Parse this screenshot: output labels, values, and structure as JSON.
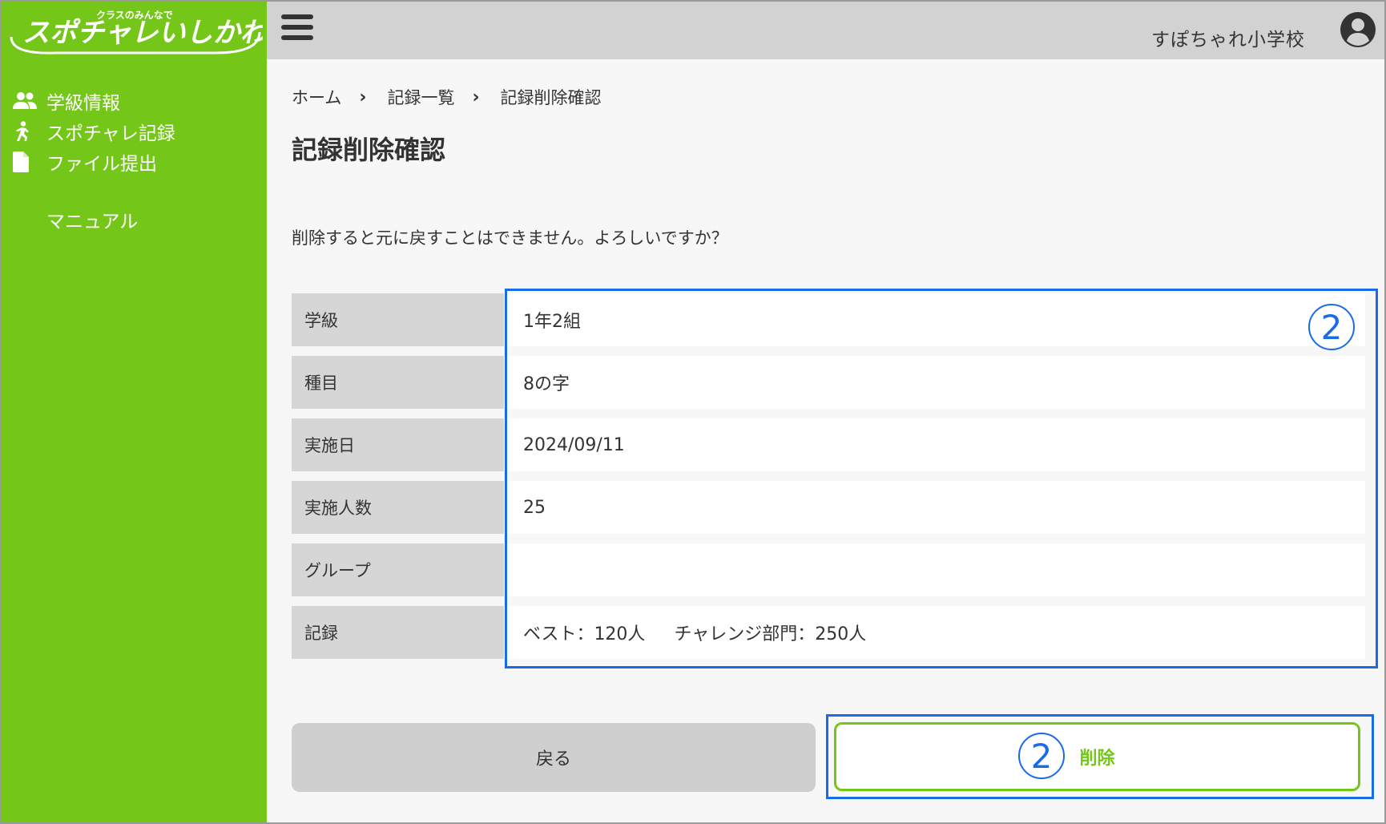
{
  "sidebar": {
    "logo_main": "スポチャレいしかわ",
    "logo_sub": "クラスのみんなで",
    "items": [
      {
        "icon": "users-icon",
        "label": "学級情報"
      },
      {
        "icon": "runner-icon",
        "label": "スポチャレ記録"
      },
      {
        "icon": "file-icon",
        "label": "ファイル提出"
      }
    ],
    "manual_label": "マニュアル"
  },
  "header": {
    "school_name": "すぽちゃれ小学校"
  },
  "breadcrumb": {
    "home": "ホーム",
    "list": "記録一覧",
    "current": "記録削除確認"
  },
  "page": {
    "title": "記録削除確認",
    "message": "削除すると元に戻すことはできません。よろしいですか？"
  },
  "table": {
    "rows": [
      {
        "label": "学級",
        "value": "1年2組"
      },
      {
        "label": "種目",
        "value": "8の字"
      },
      {
        "label": "実施日",
        "value": "2024/09/11"
      },
      {
        "label": "実施人数",
        "value": "25"
      },
      {
        "label": "グループ",
        "value": ""
      },
      {
        "label": "記録",
        "value_best": "ベスト：120人",
        "value_challenge": "チャレンジ部門：250人"
      }
    ]
  },
  "annotations": {
    "marker_table": "2",
    "marker_button": "2",
    "highlight_color": "#1a6be8"
  },
  "buttons": {
    "back_label": "戻る",
    "delete_label": "削除"
  },
  "colors": {
    "brand_green": "#74c619",
    "header_gray": "#d2d2d2"
  }
}
